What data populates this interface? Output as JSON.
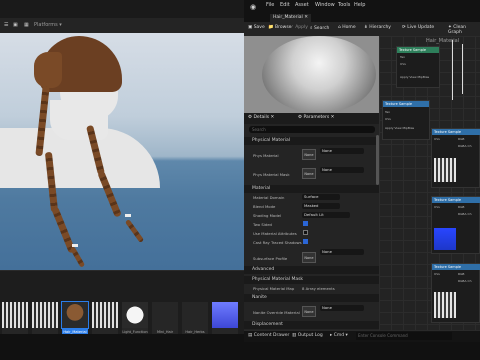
{
  "viewport_window": {
    "platforms_label": "Platforms",
    "assets": [
      {
        "label": "",
        "kind": "hair"
      },
      {
        "label": "",
        "kind": "hair"
      },
      {
        "label": "Hair_Material",
        "kind": "hair",
        "selected": true
      },
      {
        "label": "",
        "kind": "hair"
      },
      {
        "label": "Light_Function",
        "kind": "sphere"
      },
      {
        "label": "Mini_Hair",
        "kind": "dark"
      },
      {
        "label": "Hair_Herbs",
        "kind": "dark"
      },
      {
        "label": "",
        "kind": "blue"
      }
    ]
  },
  "editor": {
    "menu": [
      "File",
      "Edit",
      "Asset",
      "Window",
      "Tools",
      "Help"
    ],
    "tab_title": "Hair_Material",
    "toolbar": {
      "save": "Save",
      "browse": "Browse",
      "apply": "Apply",
      "search": "Search",
      "home": "Home",
      "hierarchy": "Hierarchy",
      "live_update": "Live Update",
      "clean_graph": "Clean Graph"
    },
    "details": {
      "tabs": [
        "Details",
        "Parameters"
      ],
      "search_placeholder": "Search",
      "sections": {
        "physical_material": "Physical Material",
        "material": "Material",
        "advanced": "Advanced",
        "physical_material_mask": "Physical Material Mask",
        "nanite": "Nanite",
        "displacement": "Displacement"
      },
      "properties": {
        "phys_material": {
          "label": "Phys Material",
          "value": "None"
        },
        "phys_material_mask": {
          "label": "Phys Material Mask",
          "value": "None"
        },
        "material_domain": {
          "label": "Material Domain",
          "value": "Surface"
        },
        "blend_mode": {
          "label": "Blend Mode",
          "value": "Masked"
        },
        "shading_model": {
          "label": "Shading Model",
          "value": "Default Lit"
        },
        "two_sided": {
          "label": "Two Sided",
          "checked": true
        },
        "use_material_attributes": {
          "label": "Use Material Attributes",
          "checked": false
        },
        "cast_ray_traced_shadows": {
          "label": "Cast Ray Traced Shadows",
          "checked": true
        },
        "subsurface_profile": {
          "label": "Subsurface Profile",
          "value": "None"
        },
        "physical_material_map": {
          "label": "Physical Material Map",
          "value": "8 Array elements"
        },
        "nanite_override_material": {
          "label": "Nanite Override Material",
          "value": "None"
        }
      },
      "none_swatch": "None"
    },
    "graph": {
      "title": "Hair_Material",
      "nodes": [
        {
          "title": "Texture Sample",
          "pins": [
            "Tex",
            "UVs",
            "Apply View MipBias"
          ]
        },
        {
          "title": "Texture Sample",
          "pins": [
            "Tex",
            "UVs",
            "Apply View MipBias"
          ]
        },
        {
          "title": "Texture Sample",
          "pins": [
            "UVs",
            "RGB",
            "RGBA Ch"
          ]
        },
        {
          "title": "Texture Sample",
          "pins": [
            "UVs",
            "RGB",
            "RGBA Ch"
          ]
        },
        {
          "title": "Texture Sample",
          "pins": [
            "UVs",
            "RGB",
            "RGBA Ch"
          ]
        }
      ]
    },
    "statusbar": {
      "content_drawer": "Content Drawer",
      "output_log": "Output Log",
      "cmd": "Cmd",
      "console_placeholder": "Enter Console Command"
    }
  }
}
